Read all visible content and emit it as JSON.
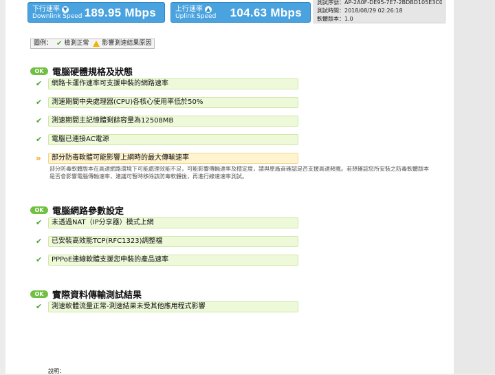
{
  "speed": {
    "download": {
      "cn": "下行速率",
      "en": "Downlink Speed",
      "value": "189.95 Mbps"
    },
    "upload": {
      "cn": "上行速率",
      "en": "Uplink Speed",
      "value": "104.63 Mbps"
    }
  },
  "info": {
    "line1": "測試序號：AP-2A0F-DE95-7E7-2BDBD105E3C0",
    "line2": "測試時間：2018/08/29 02:26:18",
    "line3": "軟體版本：1.0"
  },
  "legend": {
    "prefix": "圖例：",
    "ok": "檢測正常",
    "warn": "影響測速結果原因"
  },
  "badge_ok": "OK",
  "sections": {
    "hardware": {
      "title": "電腦硬體規格及狀態",
      "items": [
        "網路卡運作速率可支援申裝的網路速率",
        "測速期間中央處理器(CPU)各核心使用率低於50%",
        "測速期間主記憶體剩餘容量為12508MB",
        "電腦已連接AC電源"
      ],
      "warning": "部分防毒軟體可能影響上網時的最大傳輸速率",
      "note": "部分防毒軟體版本在高速網路環境下可能處理效能不足，可能影響傳輸速率及穩定度，請與原廠商確認是否支援高速頻寬。若想確認您所安裝之防毒軟體版本是否會影響電腦傳輸速率，建議可暫時移除該防毒軟體後，再進行線速速率測試。"
    },
    "network": {
      "title": "電腦網路參數設定",
      "items": [
        "未透過NAT（IP分享器）模式上網",
        "已安裝高效能TCP(RFC1323)調整檔",
        "PPPoE連線軟體支援您申裝的產品速率"
      ]
    },
    "transfer": {
      "title": "實際資料傳輸測試結果",
      "items": [
        "測速軟體流量正常-測速結果未受其他應用程式影響"
      ]
    }
  },
  "footer": {
    "label": "說明："
  },
  "colors": {
    "accent": "#4aa3df",
    "ok_green": "#71c043",
    "row_bg": "#eef9da",
    "warn_bg": "#fff3d0",
    "warn_icon": "#f0a000"
  }
}
